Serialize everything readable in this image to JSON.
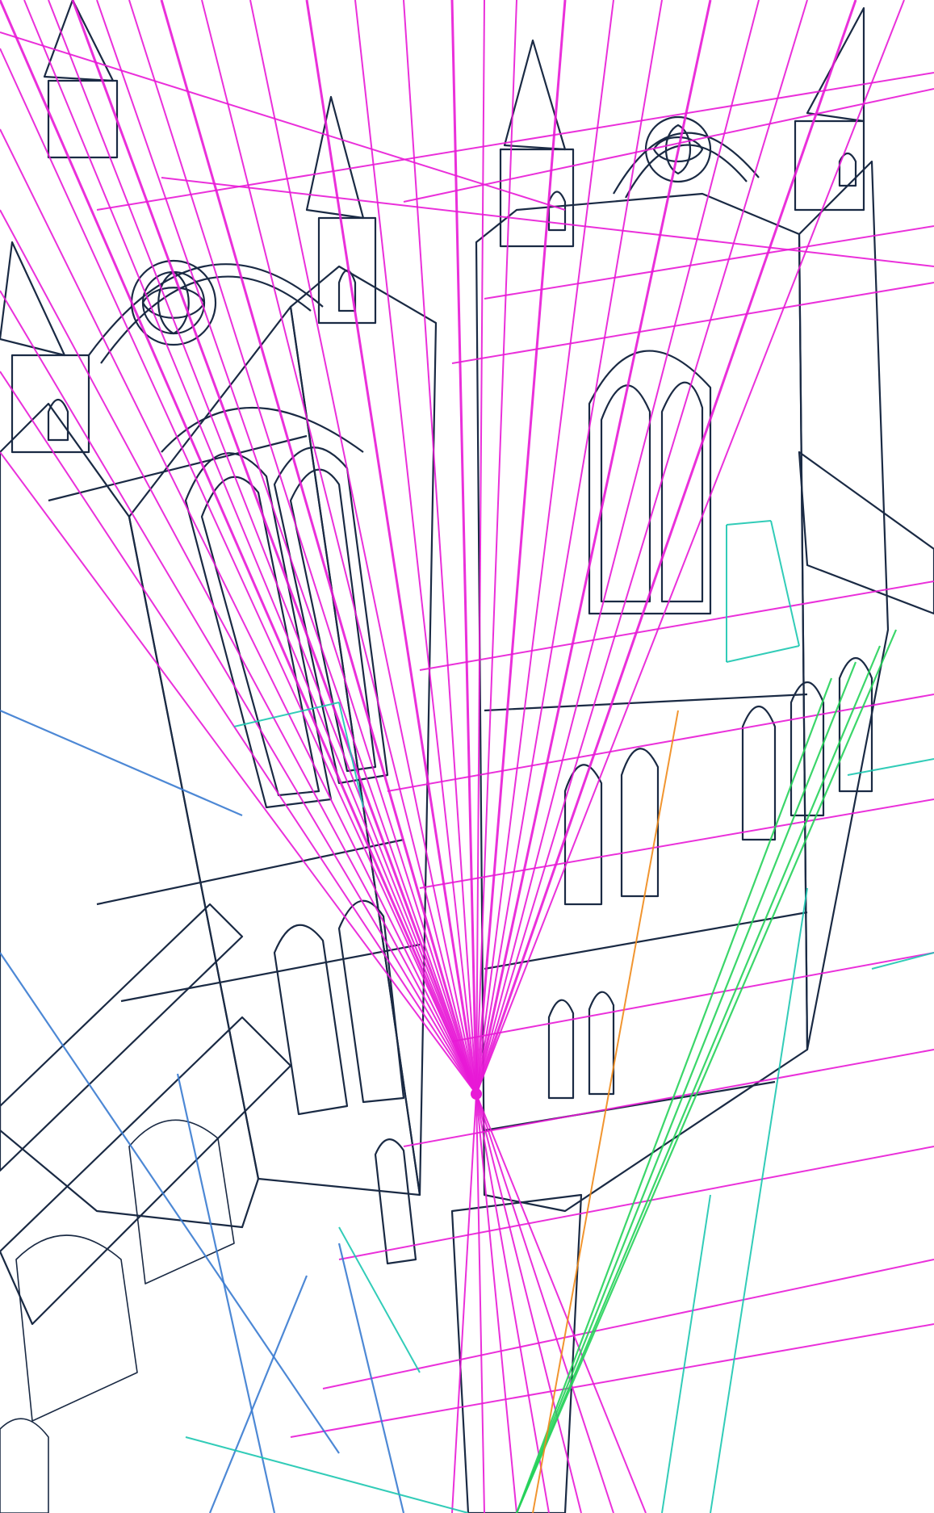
{
  "artwork": {
    "background": "#ffffff",
    "ink_color": "#1a2a44",
    "construction_colors": {
      "magenta": "#e81ad6",
      "blue": "#3a7bd0",
      "teal": "#1cc7b0",
      "green": "#26d15a",
      "orange": "#f08a1a"
    },
    "icons": [
      "cathedral-tower-drawing",
      "perspective-vanishing-point"
    ]
  }
}
